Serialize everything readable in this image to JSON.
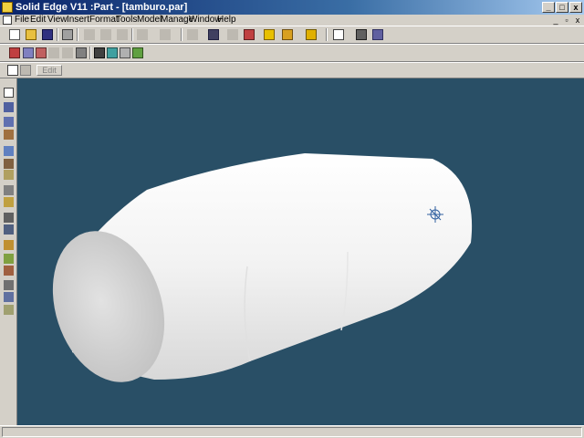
{
  "window": {
    "title": "Solid Edge V11 :Part - [tamburo.par]",
    "controls": {
      "minimize": "_",
      "maximize": "□",
      "close": "x"
    }
  },
  "menu": {
    "items": [
      "File",
      "Edit",
      "View",
      "Insert",
      "Format",
      "Tools",
      "Model",
      "Manage",
      "Window",
      "Help"
    ],
    "document_controls": {
      "minimize": "_",
      "restore": "▫",
      "close": "x"
    }
  },
  "ribbon": {
    "edit_label": "Edit"
  },
  "viewport": {
    "background_color": "#294f66",
    "part_color": "#f2f2f2",
    "part": "barrel-shaped solid part"
  },
  "icons": {
    "standard_toolbar": [
      "new-icon",
      "open-icon",
      "save-icon",
      "print-icon",
      "cut-icon",
      "copy-icon",
      "paste-icon",
      "undo-icon",
      "redo-icon",
      "pathfinder-icon",
      "save-as-icon",
      "properties-icon",
      "color-icon",
      "select-tools-icon",
      "feature-icon",
      "view-orientation-icon",
      "coordinate-icon",
      "sketch-icon"
    ],
    "view_toolbar": [
      "rotate-icon",
      "zoom-icon",
      "zoom-area-icon",
      "fit-icon",
      "pan-icon",
      "shaded-icon",
      "visible-edges-icon",
      "hidden-edges-icon"
    ],
    "feature_toolbar": [
      "select-icon",
      "sketch-plane-icon",
      "protrusion-icon",
      "revolved-protrusion-icon",
      "cutout-icon",
      "revolved-cutout-icon",
      "hole-icon",
      "round-icon",
      "chamfer-icon",
      "draft-icon",
      "thin-wall-icon",
      "rib-icon",
      "pattern-icon",
      "mirror-icon",
      "helix-icon",
      "swept-icon",
      "lofted-icon",
      "normal-protrusion-icon",
      "web-network-icon",
      "relations-icon",
      "dimension-icon",
      "axis-icon"
    ]
  }
}
